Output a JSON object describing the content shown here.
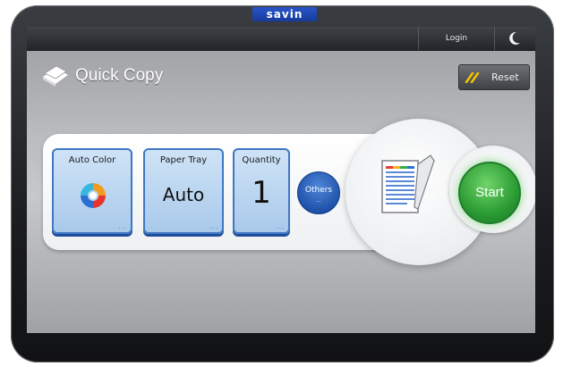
{
  "device": {
    "brand": "savin"
  },
  "topbar": {
    "login_label": "Login",
    "mode_icon": "moon-icon"
  },
  "header": {
    "title": "Quick Copy",
    "title_icon": "copy-stack-icon"
  },
  "reset": {
    "label": "Reset",
    "icon": "reset-icon"
  },
  "settings": [
    {
      "label": "Auto Color",
      "value": "",
      "icon": "color-swirl-icon"
    },
    {
      "label": "Paper Tray",
      "value": "Auto"
    },
    {
      "label": "Quantity",
      "value": "1"
    }
  ],
  "others": {
    "label": "Others",
    "indicator": "..."
  },
  "preview": {
    "icon": "document-preview-icon"
  },
  "start": {
    "label": "Start"
  },
  "colors": {
    "accent_blue": "#3f77c4",
    "start_green": "#2a9b32",
    "brand_blue": "#1e47b8"
  }
}
